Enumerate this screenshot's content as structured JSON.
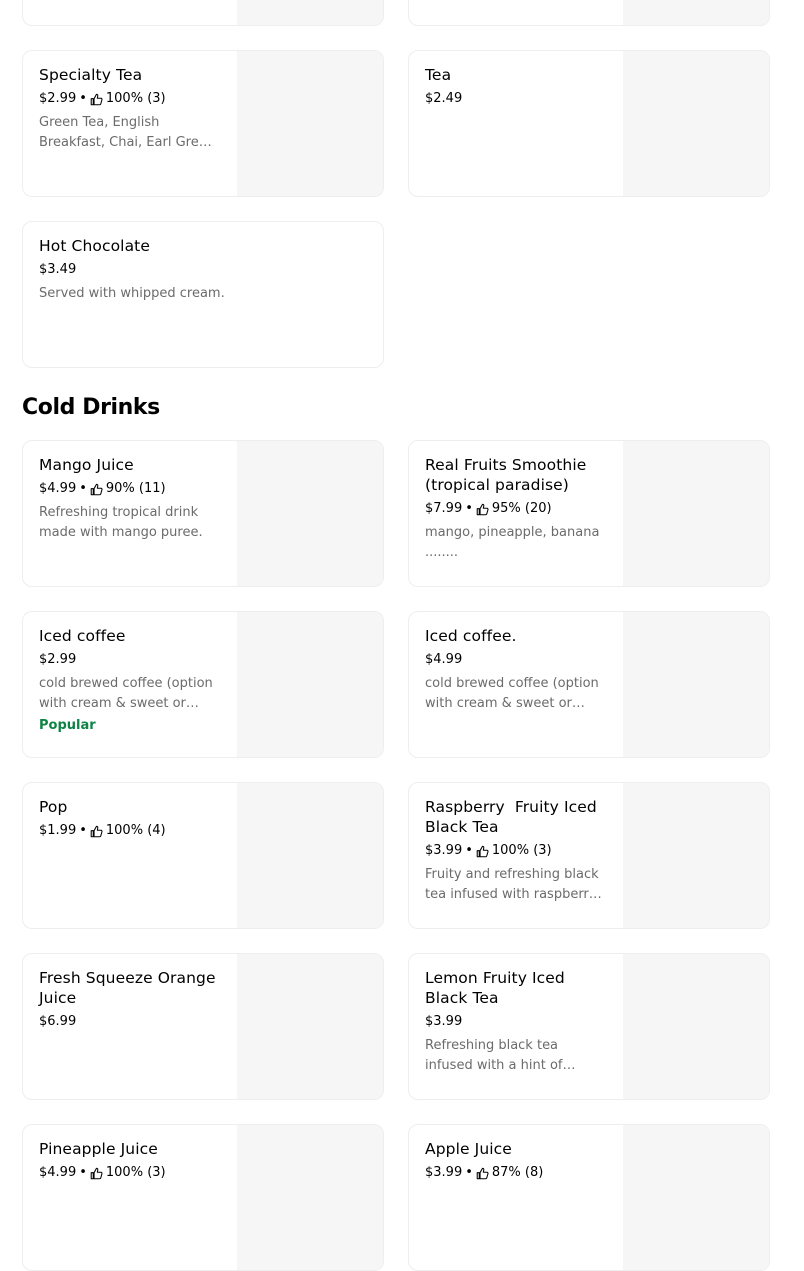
{
  "sections": {
    "cold_drinks_title": "Cold Drinks"
  },
  "items": {
    "specialty_tea": {
      "name": "Specialty Tea",
      "price": "$2.99",
      "rating": "100% (3)",
      "description": "Green Tea, English Breakfast, Chai, Earl Grey, Peppermint"
    },
    "tea": {
      "name": "Tea",
      "price": "$2.49"
    },
    "hot_chocolate": {
      "name": "Hot Chocolate",
      "price": "$3.49",
      "description": "Served with whipped cream."
    },
    "mango_juice": {
      "name": "Mango Juice",
      "price": "$4.99",
      "rating": "90% (11)",
      "description": "Refreshing tropical drink made with mango puree."
    },
    "real_fruits_smoothie": {
      "name": "Real Fruits Smoothie (tropical paradise)",
      "price": "$7.99",
      "rating": "95% (20)",
      "description": "mango, pineapple, banana ........"
    },
    "iced_coffee": {
      "name": "Iced coffee",
      "price": "$2.99",
      "description": "cold brewed coffee (option with cream & sweet or black)",
      "tag": "Popular"
    },
    "iced_coffee_2": {
      "name": "Iced coffee.",
      "price": "$4.99",
      "description": "cold brewed coffee (option with cream & sweet or black)"
    },
    "pop": {
      "name": "Pop",
      "price": "$1.99",
      "rating": "100% (4)"
    },
    "raspberry_tea": {
      "name": "Raspberry  Fruity Iced Black Tea",
      "price": "$3.99",
      "rating": "100% (3)",
      "description": "Fruity and refreshing black tea infused with raspberry flavour."
    },
    "orange_juice": {
      "name": "Fresh Squeeze Orange Juice",
      "price": "$6.99"
    },
    "lemon_tea": {
      "name": "Lemon Fruity Iced Black Tea",
      "price": "$3.99",
      "description": "Refreshing black tea infused with a hint of lemon and sweetness."
    },
    "pineapple_juice": {
      "name": "Pineapple Juice",
      "price": "$4.99",
      "rating": "100% (3)"
    },
    "apple_juice": {
      "name": "Apple Juice",
      "price": "$3.99",
      "rating": "87% (8)"
    }
  },
  "icons": {
    "rating": "thumbs-up-icon",
    "separator": "•"
  },
  "colors": {
    "popular": "#0e8345",
    "description": "#6b6b6b",
    "image_placeholder": "#f6f6f6",
    "card_border": "#eeeeee"
  }
}
